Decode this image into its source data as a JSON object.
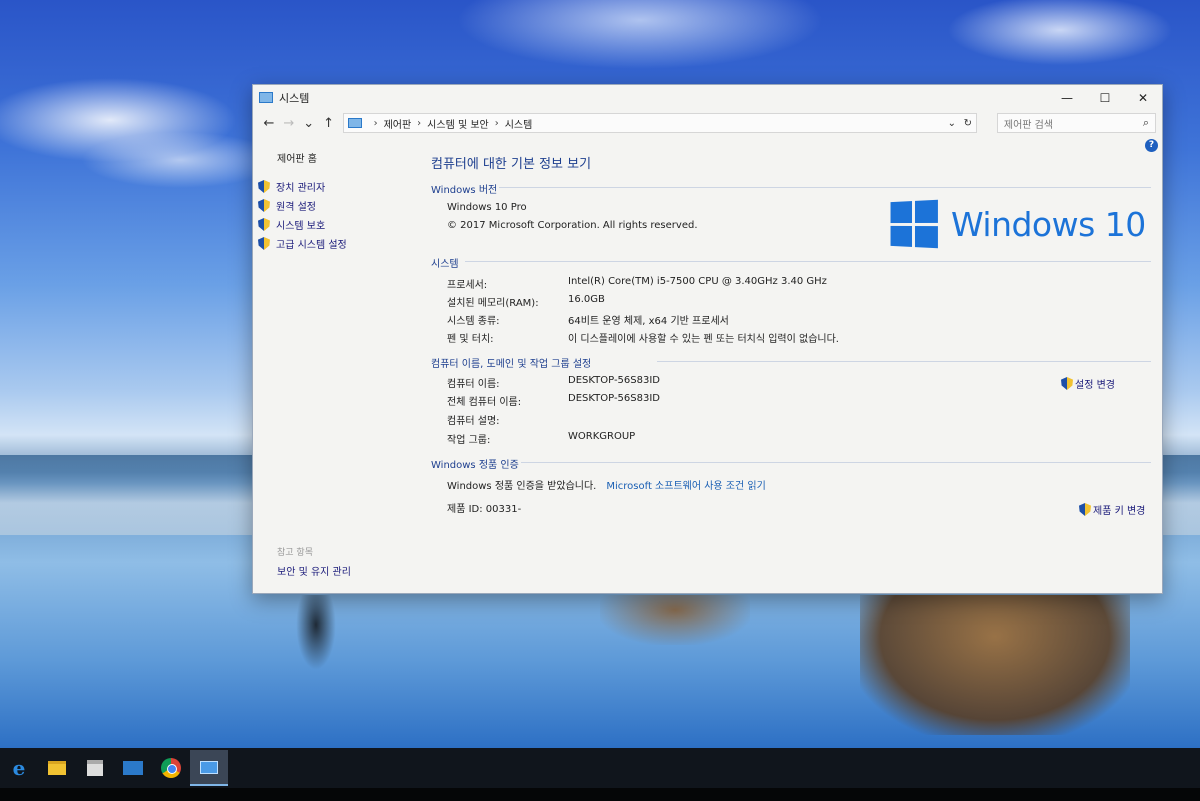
{
  "window": {
    "title": "시스템",
    "controls": {
      "minimize": "—",
      "maximize": "☐",
      "close": "✕"
    }
  },
  "addressbar": {
    "back": "←",
    "forward": "→",
    "recent": "⌄",
    "up": "↑",
    "breadcrumbs": [
      "제어판",
      "시스템 및 보안",
      "시스템"
    ],
    "dropdown": "⌄",
    "refresh": "↻",
    "search_placeholder": "제어판 검색",
    "search_icon": "⌕"
  },
  "help_icon": "?",
  "sidebar": {
    "home": "제어판 홈",
    "items": [
      {
        "label": "장치 관리자",
        "icon": "shield-icon"
      },
      {
        "label": "원격 설정",
        "icon": "shield-icon"
      },
      {
        "label": "시스템 보호",
        "icon": "shield-icon"
      },
      {
        "label": "고급 시스템 설정",
        "icon": "shield-icon"
      }
    ],
    "see_also": "참고 항목",
    "security_link": "보안 및 유지 관리"
  },
  "main": {
    "page_title": "컴퓨터에 대한 기본 정보 보기",
    "edition": {
      "heading": "Windows 버전",
      "name": "Windows 10 Pro",
      "copyright": "© 2017 Microsoft Corporation. All rights reserved."
    },
    "logo_text": "Windows 10",
    "system": {
      "heading": "시스템",
      "rows": [
        {
          "label": "프로세서:",
          "value": "Intel(R) Core(TM) i5-7500 CPU @ 3.40GHz   3.40 GHz"
        },
        {
          "label": "설치된 메모리(RAM):",
          "value": "16.0GB"
        },
        {
          "label": "시스템 종류:",
          "value": "64비트 운영 체제, x64 기반 프로세서"
        },
        {
          "label": "펜 및 터치:",
          "value": "이 디스플레이에 사용할 수 있는 펜 또는 터치식 입력이 없습니다."
        }
      ]
    },
    "computer_name": {
      "heading": "컴퓨터 이름, 도메인 및 작업 그룹 설정",
      "rows": [
        {
          "label": "컴퓨터 이름:",
          "value": "DESKTOP-56S83ID"
        },
        {
          "label": "전체 컴퓨터 이름:",
          "value": "DESKTOP-56S83ID"
        },
        {
          "label": "컴퓨터 설명:",
          "value": ""
        },
        {
          "label": "작업 그룹:",
          "value": "WORKGROUP"
        }
      ],
      "change_settings": "설정 변경"
    },
    "activation": {
      "heading": "Windows 정품 인증",
      "status": "Windows 정품 인증을 받았습니다.",
      "license_link": "Microsoft 소프트웨어 사용 조건 읽기",
      "product_id": "제품 ID: 00331-",
      "change_key": "제품 키 변경"
    }
  },
  "taskbar": {
    "items": [
      "edge-icon",
      "file-explorer-icon",
      "store-icon",
      "mail-icon",
      "chrome-icon",
      "system-icon"
    ],
    "edge_glyph": "e"
  },
  "colors": {
    "accent": "#1c73d8",
    "heading": "#1e3f8f",
    "link": "#1a5fb4"
  }
}
